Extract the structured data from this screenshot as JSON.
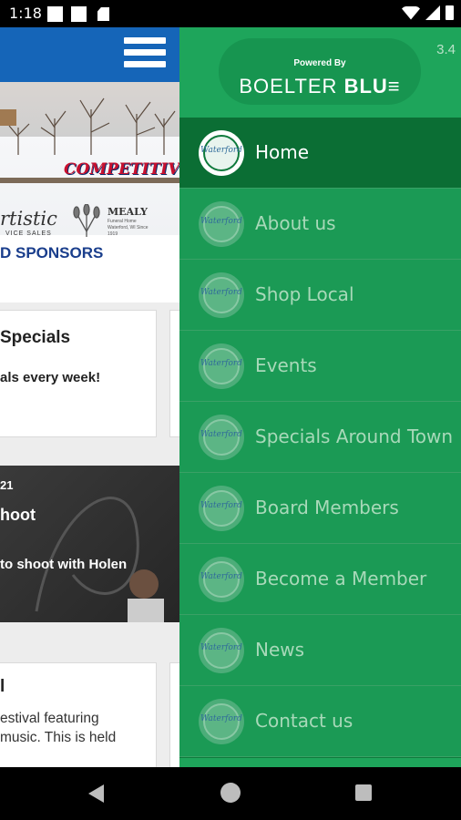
{
  "status_bar": {
    "time": "1:18"
  },
  "background_page": {
    "banner": {
      "sponsor_logo_competitive": "COMPETITIVE",
      "sponsor_logo_artistic": "rtistic",
      "sponsor_logo_artistic_sub": "VICE  SALES",
      "sponsor_logo_mealy": "MEALY",
      "sponsor_logo_mealy_sub": "Funeral Home Waterford, WI Since 1919",
      "sponsors_heading": "D SPONSORS"
    },
    "card_specials": {
      "title": "Specials",
      "text": "als every week!"
    },
    "photo_card": {
      "date": "21",
      "title": "hoot",
      "text": "to shoot with Holen"
    },
    "card_festival": {
      "title": "l",
      "line1": "estival featuring",
      "line2": "music. This is held"
    }
  },
  "drawer": {
    "powered_by": "Powered By",
    "brand_light": "BOELTER ",
    "brand_bold": "BLU≡",
    "version": "3.4",
    "icon_text": "Waterford",
    "items": [
      {
        "label": "Home",
        "active": true
      },
      {
        "label": "About us"
      },
      {
        "label": "Shop Local"
      },
      {
        "label": "Events"
      },
      {
        "label": "Specials Around Town"
      },
      {
        "label": "Board Members"
      },
      {
        "label": "Become a Member"
      },
      {
        "label": "News"
      },
      {
        "label": "Contact us"
      }
    ]
  },
  "colors": {
    "drawer_green": "#1b9a55",
    "drawer_active": "#0b6e34",
    "header_green": "#1ea55b",
    "app_bar_blue": "#1565b8"
  }
}
